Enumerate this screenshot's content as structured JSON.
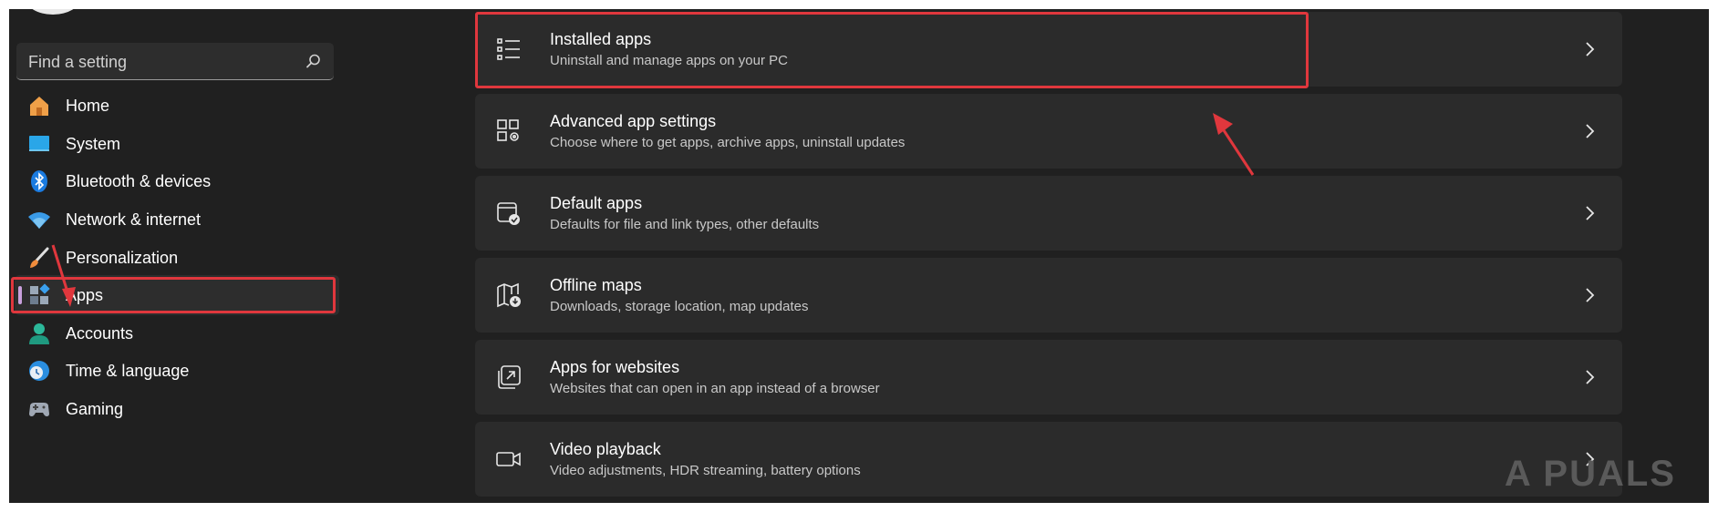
{
  "search": {
    "placeholder": "Find a setting"
  },
  "sidebar": {
    "items": [
      {
        "label": "Home",
        "icon": "home-icon"
      },
      {
        "label": "System",
        "icon": "system-icon"
      },
      {
        "label": "Bluetooth & devices",
        "icon": "bluetooth-icon"
      },
      {
        "label": "Network & internet",
        "icon": "wifi-icon"
      },
      {
        "label": "Personalization",
        "icon": "brush-icon"
      },
      {
        "label": "Apps",
        "icon": "apps-icon",
        "selected": true
      },
      {
        "label": "Accounts",
        "icon": "account-icon"
      },
      {
        "label": "Time & language",
        "icon": "clock-globe-icon"
      },
      {
        "label": "Gaming",
        "icon": "gamepad-icon"
      }
    ]
  },
  "main": {
    "cards": [
      {
        "title": "Installed apps",
        "subtitle": "Uninstall and manage apps on your PC",
        "icon": "list-icon"
      },
      {
        "title": "Advanced app settings",
        "subtitle": "Choose where to get apps, archive apps, uninstall updates",
        "icon": "app-settings-icon"
      },
      {
        "title": "Default apps",
        "subtitle": "Defaults for file and link types, other defaults",
        "icon": "default-apps-icon"
      },
      {
        "title": "Offline maps",
        "subtitle": "Downloads, storage location, map updates",
        "icon": "map-download-icon"
      },
      {
        "title": "Apps for websites",
        "subtitle": "Websites that can open in an app instead of a browser",
        "icon": "open-link-icon"
      },
      {
        "title": "Video playback",
        "subtitle": "Video adjustments, HDR streaming, battery options",
        "icon": "video-icon"
      }
    ]
  },
  "watermark": {
    "text": "A PUALS"
  },
  "colors": {
    "background": "#202020",
    "card": "#2b2b2b",
    "highlight": "#e0373d",
    "selected_indicator": "#c9a0dc"
  }
}
